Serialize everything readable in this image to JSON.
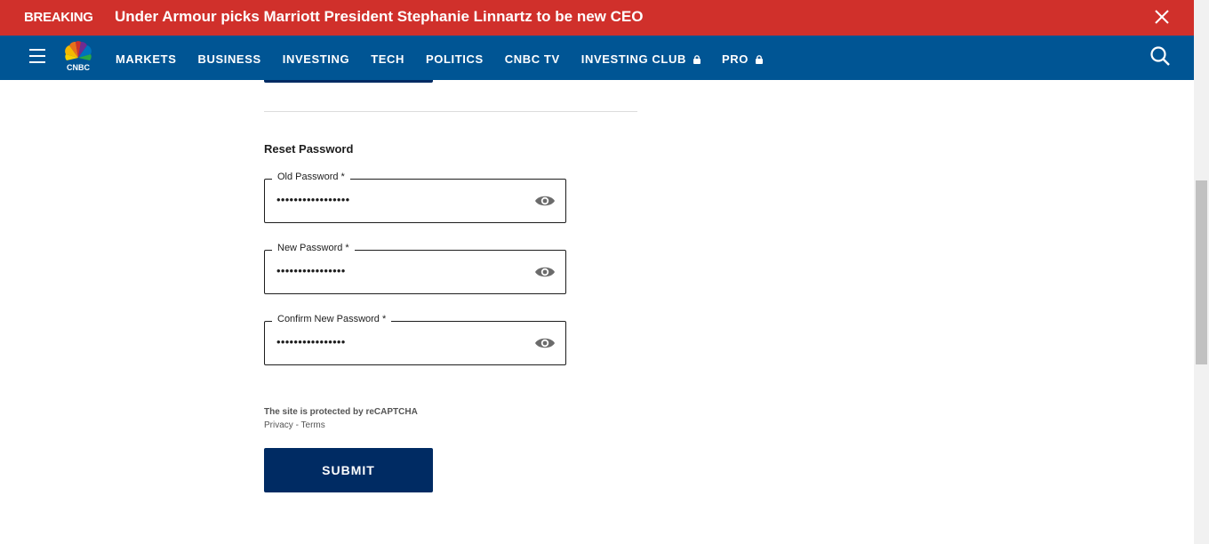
{
  "breaking": {
    "tag": "BREAKING",
    "headline": "Under Armour picks Marriott President Stephanie Linnartz to be new CEO"
  },
  "nav": {
    "logo_text": "CNBC",
    "items": [
      {
        "label": "MARKETS",
        "locked": false
      },
      {
        "label": "BUSINESS",
        "locked": false
      },
      {
        "label": "INVESTING",
        "locked": false
      },
      {
        "label": "TECH",
        "locked": false
      },
      {
        "label": "POLITICS",
        "locked": false
      },
      {
        "label": "CNBC TV",
        "locked": false
      },
      {
        "label": "INVESTING CLUB",
        "locked": true
      },
      {
        "label": "PRO",
        "locked": true
      }
    ]
  },
  "form": {
    "section_title": "Reset Password",
    "fields": [
      {
        "label": "Old Password",
        "required_mark": "*",
        "value": "•••••••••••••••••"
      },
      {
        "label": "New Password",
        "required_mark": "*",
        "value": "••••••••••••••••"
      },
      {
        "label": "Confirm New Password",
        "required_mark": "*",
        "value": "••••••••••••••••"
      }
    ],
    "recaptcha_text": "The site is protected by reCAPTCHA",
    "privacy_label": "Privacy",
    "separator": " - ",
    "terms_label": "Terms",
    "submit_label": "SUBMIT"
  },
  "colors": {
    "breaking_bg": "#d0302b",
    "nav_bg": "#005594",
    "button_bg": "#002b63"
  }
}
